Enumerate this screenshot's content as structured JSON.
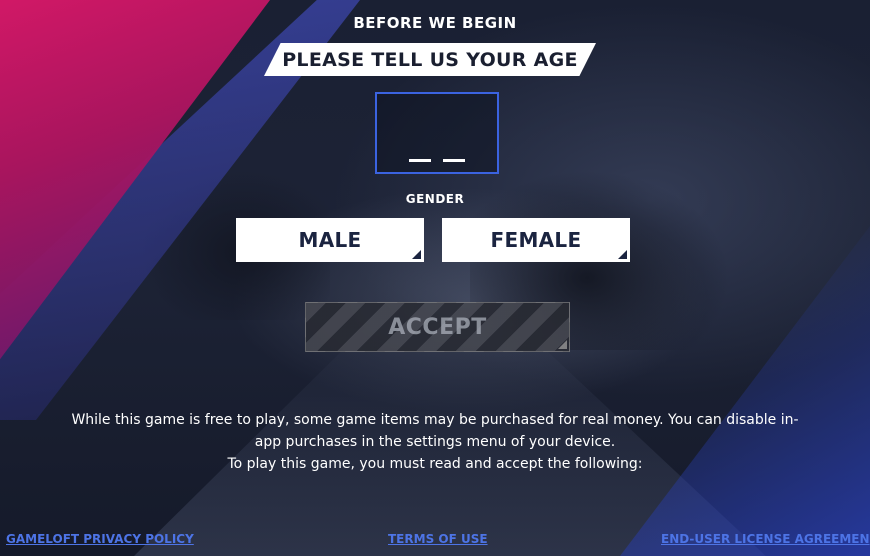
{
  "header": {
    "title": "BEFORE WE BEGIN",
    "age_prompt": "PLEASE TELL US YOUR AGE"
  },
  "age_input": {
    "value": ""
  },
  "gender": {
    "label": "GENDER",
    "options": [
      "MALE",
      "FEMALE"
    ]
  },
  "accept_button": {
    "label": "ACCEPT"
  },
  "notice": {
    "line1": "While this game is free to play, some game items may be purchased for real money. You can disable in-",
    "line2": "app purchases in the settings menu of your device.",
    "line3": "To play this game, you must read and accept the following:"
  },
  "links": {
    "privacy": "GAMELOFT PRIVACY POLICY",
    "terms": "TERMS OF USE",
    "eula": "END-USER LICENSE AGREEMEN"
  },
  "colors": {
    "accent_blue": "#3b63e0",
    "link_blue": "#4d74e6",
    "brand_pink": "#e0186a",
    "background": "#151b2e"
  }
}
